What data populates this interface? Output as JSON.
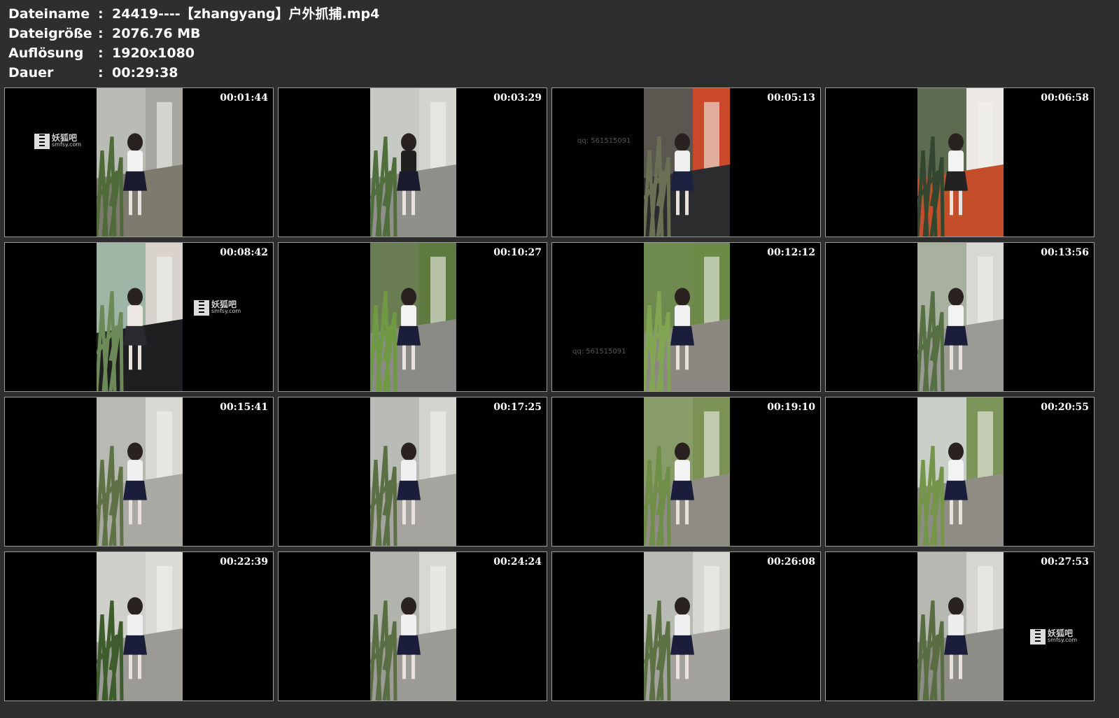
{
  "meta": {
    "filename_label": "Dateiname",
    "filename_value": "24419----【zhangyang】户外抓捕.mp4",
    "size_label": "Dateigröße",
    "size_value": "2076.76 MB",
    "resolution_label": "Auflösung",
    "resolution_value": "1920x1080",
    "duration_label": "Dauer",
    "duration_value": "00:29:38",
    "separator": ":"
  },
  "thumbnails": [
    {
      "time": "00:01:44"
    },
    {
      "time": "00:03:29"
    },
    {
      "time": "00:05:13"
    },
    {
      "time": "00:06:58"
    },
    {
      "time": "00:08:42"
    },
    {
      "time": "00:10:27"
    },
    {
      "time": "00:12:12"
    },
    {
      "time": "00:13:56"
    },
    {
      "time": "00:15:41"
    },
    {
      "time": "00:17:25"
    },
    {
      "time": "00:19:10"
    },
    {
      "time": "00:20:55"
    },
    {
      "time": "00:22:39"
    },
    {
      "time": "00:24:24"
    },
    {
      "time": "00:26:08"
    },
    {
      "time": "00:27:53"
    }
  ],
  "watermark": {
    "logo_text": "妖狐吧",
    "url_text": "smfsy.com",
    "qq_text": "qq: 561515091"
  },
  "colors": {
    "background": "#2e2e2e",
    "thumb_border": "#9a9a9a",
    "text": "#ffffff"
  }
}
